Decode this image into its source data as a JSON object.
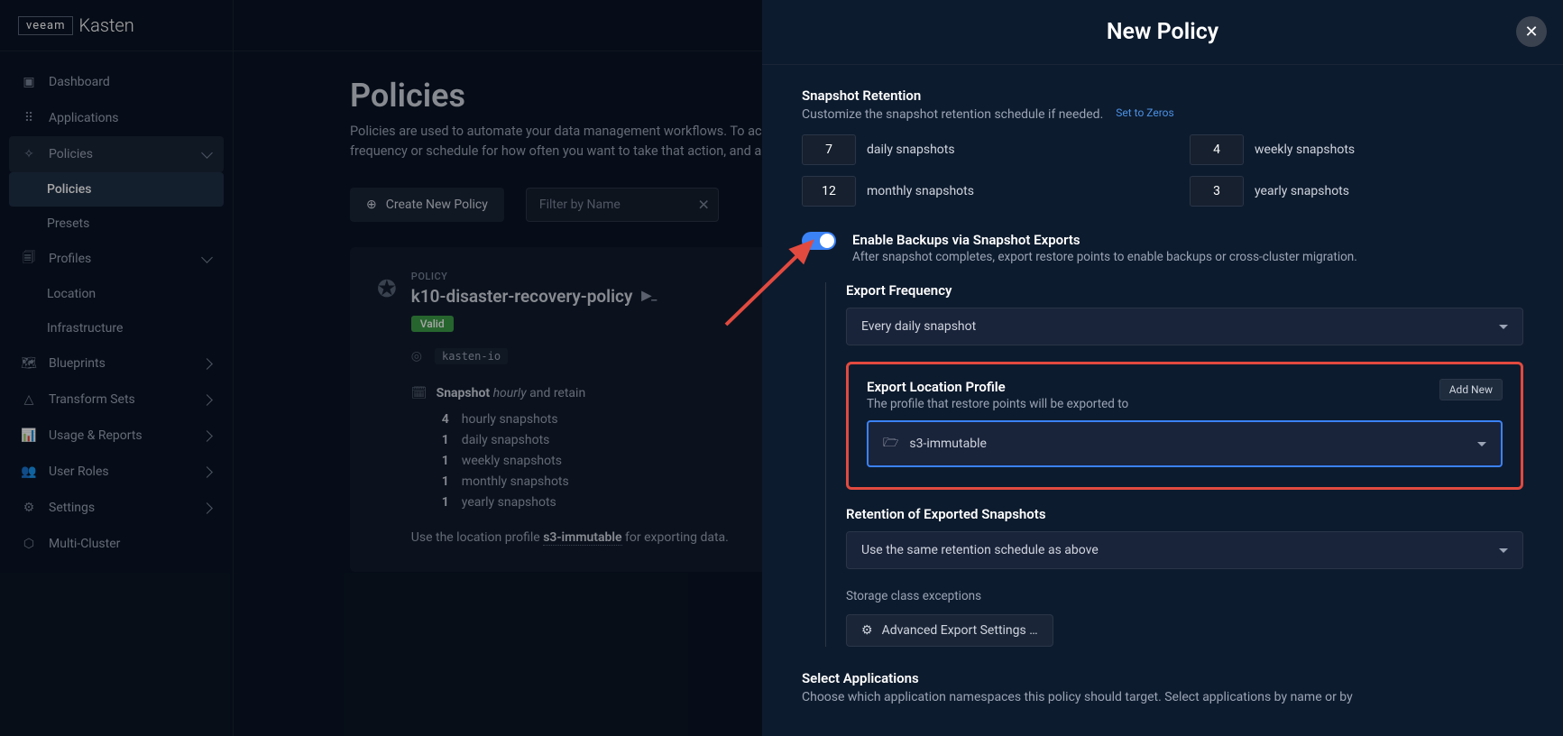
{
  "logo": {
    "veeam": "veeam",
    "kasten": "Kasten"
  },
  "nav": {
    "dashboard": "Dashboard",
    "applications": "Applications",
    "policies": "Policies",
    "policies_sub": "Policies",
    "presets": "Presets",
    "profiles": "Profiles",
    "location": "Location",
    "infrastructure": "Infrastructure",
    "blueprints": "Blueprints",
    "transformsets": "Transform Sets",
    "usage": "Usage & Reports",
    "userroles": "User Roles",
    "settings": "Settings",
    "multicluster": "Multi-Cluster"
  },
  "page": {
    "title": "Policies",
    "desc": "Policies are used to automate your data management workflows. To achieve this, they combine actions you want to take (e.g., snapshot), a frequency or schedule for how often you want to take that action, and a label-based selection criteria for the resources you want to manage.",
    "create_btn": "Create New Policy",
    "filter_ph": "Filter by Name"
  },
  "card": {
    "label": "POLICY",
    "name": "k10-disaster-recovery-policy",
    "badge": "Valid",
    "ns": "kasten-io",
    "snapshot_word": "Snapshot",
    "freq": "hourly",
    "and_retain": " and retain",
    "retain": [
      {
        "n": "4",
        "t": "hourly snapshots"
      },
      {
        "n": "1",
        "t": "daily snapshots"
      },
      {
        "n": "1",
        "t": "weekly snapshots"
      },
      {
        "n": "1",
        "t": "monthly snapshots"
      },
      {
        "n": "1",
        "t": "yearly snapshots"
      }
    ],
    "loc_pre": "Use the location profile ",
    "loc_profile": "s3-immutable",
    "loc_post": " for exporting data."
  },
  "panel": {
    "title": "New Policy",
    "snapshot_ret_title": "Snapshot Retention",
    "snapshot_ret_sub": "Customize the snapshot retention schedule if needed.",
    "zeros": "Set to Zeros",
    "ret": {
      "daily_n": "7",
      "daily_l": "daily snapshots",
      "weekly_n": "4",
      "weekly_l": "weekly snapshots",
      "monthly_n": "12",
      "monthly_l": "monthly snapshots",
      "yearly_n": "3",
      "yearly_l": "yearly snapshots"
    },
    "enable_title": "Enable Backups via Snapshot Exports",
    "enable_sub": "After snapshot completes, export restore points to enable backups or cross-cluster migration.",
    "export_freq_label": "Export Frequency",
    "export_freq_value": "Every daily snapshot",
    "export_loc_title": "Export Location Profile",
    "export_loc_sub": "The profile that restore points will be exported to",
    "addnew": "Add New",
    "export_loc_value": "s3-immutable",
    "ret_exp_title": "Retention of Exported Snapshots",
    "ret_exp_value": "Use the same retention schedule as above",
    "sce": "Storage class exceptions",
    "adv_btn": "Advanced Export Settings …",
    "select_apps_title": "Select Applications",
    "select_apps_sub": "Choose which application namespaces this policy should target. Select applications by name or by"
  }
}
